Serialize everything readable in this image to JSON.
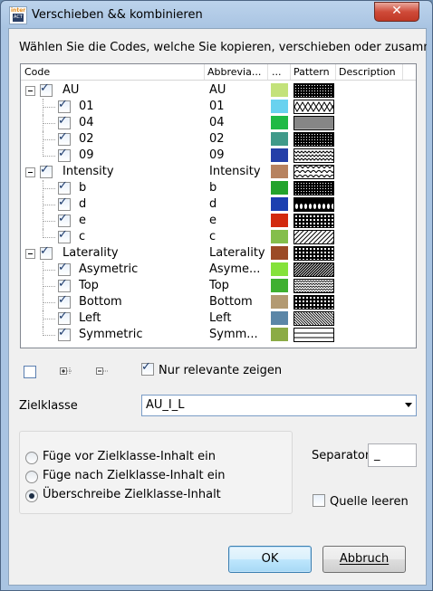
{
  "window": {
    "title": "Verschieben && kombinieren",
    "app_icon_top": "inter",
    "app_icon_bottom": "ACT",
    "close_glyph": "✕"
  },
  "intro_text": "Wählen Sie die Codes, welche Sie kopieren, verschieben oder zusammenhä",
  "tree": {
    "columns": {
      "code": "Code",
      "abbreviation": "Abbrevia...",
      "color": "...",
      "pattern": "Pattern",
      "description": "Description"
    },
    "rows": [
      {
        "code": "AU",
        "abbr": "AU",
        "color": "#c3e27a",
        "pattern": "dots-dense",
        "level": 0,
        "checked": true
      },
      {
        "code": "01",
        "abbr": "01",
        "color": "#69d2ef",
        "pattern": "diamond",
        "level": 1,
        "checked": true
      },
      {
        "code": "04",
        "abbr": "04",
        "color": "#1fba45",
        "pattern": "grid-fine",
        "level": 1,
        "checked": true
      },
      {
        "code": "02",
        "abbr": "02",
        "color": "#3f9a8a",
        "pattern": "dots-dense",
        "level": 1,
        "checked": true
      },
      {
        "code": "09",
        "abbr": "09",
        "color": "#243fa8",
        "pattern": "zigzag",
        "level": 1,
        "checked": true
      },
      {
        "code": "Intensity",
        "abbr": "Intensity",
        "color": "#b7825f",
        "pattern": "scales",
        "level": 0,
        "checked": true
      },
      {
        "code": "b",
        "abbr": "b",
        "color": "#22a32c",
        "pattern": "dots-dense",
        "level": 1,
        "checked": true
      },
      {
        "code": "d",
        "abbr": "d",
        "color": "#1b3fb0",
        "pattern": "waves",
        "level": 1,
        "checked": true
      },
      {
        "code": "e",
        "abbr": "e",
        "color": "#d22a0e",
        "pattern": "grid-coarse",
        "level": 1,
        "checked": true
      },
      {
        "code": "c",
        "abbr": "c",
        "color": "#84be4b",
        "pattern": "diag-wide",
        "level": 1,
        "checked": true
      },
      {
        "code": "Laterality",
        "abbr": "Laterality",
        "color": "#9c4a26",
        "pattern": "grid-coarse",
        "level": 0,
        "checked": true
      },
      {
        "code": "Asymetric",
        "abbr": "Asyme...",
        "color": "#84e23a",
        "pattern": "diag-dense",
        "level": 1,
        "checked": true
      },
      {
        "code": "Top",
        "abbr": "Top",
        "color": "#3fb030",
        "pattern": "zigzag-small",
        "level": 1,
        "checked": true
      },
      {
        "code": "Bottom",
        "abbr": "Bottom",
        "color": "#b39a72",
        "pattern": "grid-coarse",
        "level": 1,
        "checked": true
      },
      {
        "code": "Left",
        "abbr": "Left",
        "color": "#5b86a7",
        "pattern": "diag-back",
        "level": 1,
        "checked": true
      },
      {
        "code": "Symmetric",
        "abbr": "Symm...",
        "color": "#8bab45",
        "pattern": "lines-h",
        "level": 1,
        "checked": true
      }
    ]
  },
  "toolbar": {
    "icons": [
      "checkbox-square-icon",
      "expand-all-icon",
      "collapse-all-icon"
    ],
    "only_relevant_label": "Nur relevante zeigen",
    "only_relevant_checked": true
  },
  "target": {
    "label": "Zielklasse",
    "value": "AU_I_L"
  },
  "options": {
    "radios": [
      {
        "label": "Füge vor Zielklasse-Inhalt ein",
        "selected": false
      },
      {
        "label": "Füge nach Zielklasse-Inhalt ein",
        "selected": false
      },
      {
        "label": "Überschreibe Zielklasse-Inhalt",
        "selected": true
      }
    ],
    "separator_label": "Separator",
    "separator_value": "_",
    "clear_source_label": "Quelle leeren",
    "clear_source_checked": false
  },
  "buttons": {
    "ok": "OK",
    "cancel": "Abbruch"
  }
}
